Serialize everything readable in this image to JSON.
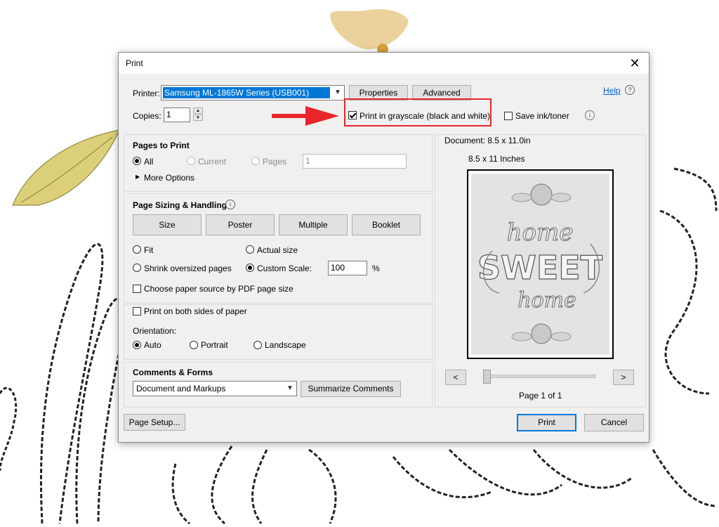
{
  "dialog": {
    "title": "Print",
    "close_glyph": "✕"
  },
  "printer": {
    "label": "Printer:",
    "selected": "Samsung ML-1865W Series (USB001)",
    "properties": "Properties",
    "advanced": "Advanced",
    "help": "Help"
  },
  "copies": {
    "label": "Copies:",
    "value": "1"
  },
  "options": {
    "grayscale": "Print in grayscale (black and white)",
    "grayscale_checked": true,
    "save_ink": "Save ink/toner",
    "save_ink_checked": false
  },
  "pages_to_print": {
    "title": "Pages to Print",
    "all": "All",
    "current": "Current",
    "pages": "Pages",
    "pages_value": "1",
    "more_options": "More Options"
  },
  "sizing": {
    "title": "Page Sizing & Handling",
    "tab_size": "Size",
    "tab_poster": "Poster",
    "tab_multiple": "Multiple",
    "tab_booklet": "Booklet",
    "fit": "Fit",
    "actual_size": "Actual size",
    "shrink": "Shrink oversized pages",
    "custom_scale": "Custom Scale:",
    "scale_value": "100",
    "percent": "%",
    "paper_source": "Choose paper source by PDF page size"
  },
  "duplex": {
    "both_sides": "Print on both sides of paper"
  },
  "orientation": {
    "label": "Orientation:",
    "auto": "Auto",
    "portrait": "Portrait",
    "landscape": "Landscape"
  },
  "comments": {
    "title": "Comments & Forms",
    "selected": "Document and Markups",
    "summarize": "Summarize Comments"
  },
  "preview": {
    "document_size": "Document: 8.5 x 11.0in",
    "paper_size": "8.5 x 11 Inches",
    "page_indicator": "Page 1 of 1",
    "prev": "<",
    "next": ">",
    "art_words": [
      "home",
      "SWEET",
      "home"
    ]
  },
  "footer": {
    "page_setup": "Page Setup...",
    "print": "Print",
    "cancel": "Cancel"
  },
  "colors": {
    "selection": "#0078d7",
    "annotation_red": "#e8262a",
    "primary_border": "#0078d7"
  }
}
